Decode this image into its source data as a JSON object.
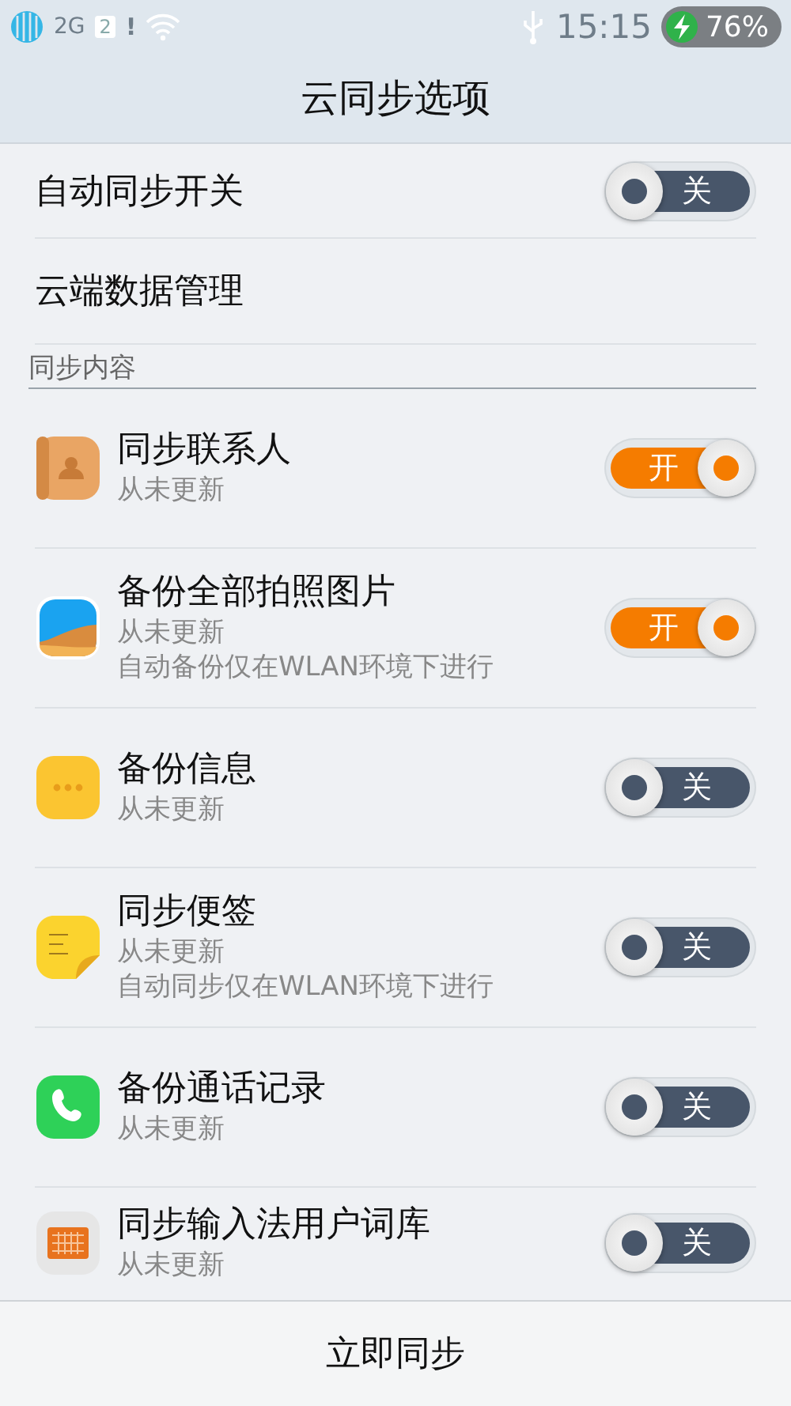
{
  "status_bar": {
    "network": "2G",
    "sim": "2",
    "sim_alert": "!",
    "time": "15:15",
    "battery": "76%",
    "charging": true
  },
  "title": "云同步选项",
  "settings": [
    {
      "label": "自动同步开关",
      "toggle": {
        "on": false,
        "label": "关"
      }
    },
    {
      "label": "云端数据管理"
    }
  ],
  "section": "同步内容",
  "items": [
    {
      "kind": "contacts",
      "title": "同步联系人",
      "subtitle": "从未更新",
      "toggle": {
        "on": true,
        "label": "开"
      }
    },
    {
      "kind": "photos",
      "title": "备份全部拍照图片",
      "subtitle": "从未更新",
      "note": "自动备份仅在WLAN环境下进行",
      "toggle": {
        "on": true,
        "label": "开"
      }
    },
    {
      "kind": "messages",
      "title": "备份信息",
      "subtitle": "从未更新",
      "toggle": {
        "on": false,
        "label": "关"
      }
    },
    {
      "kind": "notes",
      "title": "同步便签",
      "subtitle": "从未更新",
      "note": "自动同步仅在WLAN环境下进行",
      "toggle": {
        "on": false,
        "label": "关"
      }
    },
    {
      "kind": "phone",
      "title": "备份通话记录",
      "subtitle": "从未更新",
      "toggle": {
        "on": false,
        "label": "关"
      }
    },
    {
      "kind": "keyboard",
      "title": "同步输入法用户词库",
      "subtitle": "从未更新",
      "toggle": {
        "on": false,
        "label": "关"
      }
    }
  ],
  "bottom_button": "立即同步"
}
